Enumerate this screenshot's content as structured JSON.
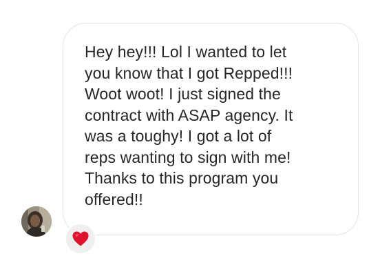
{
  "message": {
    "text": "Hey hey!!! Lol I wanted to let\nyou know that I got Repped!!!\nWoot woot! I just signed the\ncontract with ASAP agency. It\nwas a toughy! I got a lot of\nreps wanting to sign with me!\nThanks to this program you\noffered!!"
  },
  "sender": {
    "avatar_icon": "user-avatar-photo"
  },
  "reaction": {
    "icon": "red-heart-icon",
    "color": "#e0122c"
  },
  "colors": {
    "bubble_border": "#e3e3e3",
    "text": "#262626",
    "reaction_bg": "#efefef"
  }
}
